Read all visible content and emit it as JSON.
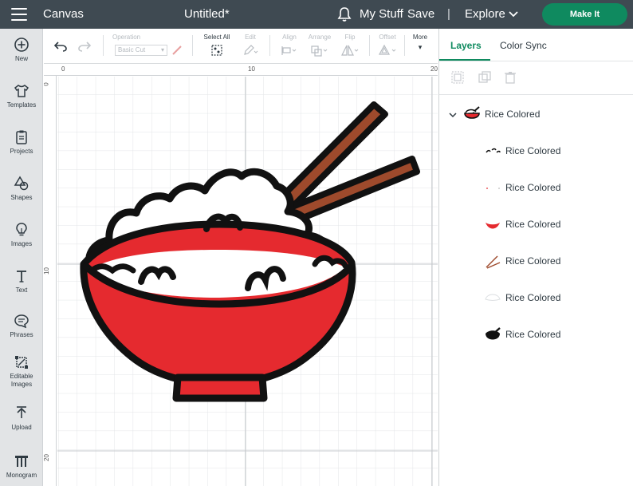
{
  "topbar": {
    "app_name": "Canvas",
    "doc_title": "Untitled*",
    "my_stuff": "My Stuff",
    "save": "Save",
    "separator": "|",
    "explore": "Explore",
    "make_it": "Make It",
    "make_it_color": "#0f8a5f",
    "bar_color": "#3f4a52"
  },
  "leftrail": {
    "items": [
      {
        "label": "New",
        "icon": "plus-circle-icon"
      },
      {
        "label": "Templates",
        "icon": "shirt-icon"
      },
      {
        "label": "Projects",
        "icon": "clipboard-icon"
      },
      {
        "label": "Shapes",
        "icon": "shapes-icon"
      },
      {
        "label": "Images",
        "icon": "lightbulb-icon"
      },
      {
        "label": "Text",
        "icon": "text-t-icon"
      },
      {
        "label": "Phrases",
        "icon": "speech-bubble-icon"
      },
      {
        "label": "Editable Images",
        "icon": "editable-images-icon"
      },
      {
        "label": "Upload",
        "icon": "upload-icon"
      },
      {
        "label": "Monogram",
        "icon": "monogram-icon"
      }
    ]
  },
  "toolbar": {
    "operation_label": "Operation",
    "operation_value": "Basic Cut",
    "select_all": "Select All",
    "edit": "Edit",
    "align": "Align",
    "arrange": "Arrange",
    "flip": "Flip",
    "offset": "Offset",
    "more": "More"
  },
  "rulers": {
    "top": [
      "0",
      "10",
      "20"
    ],
    "left": [
      "0",
      "10",
      "20"
    ]
  },
  "rightpanel": {
    "tabs": [
      "Layers",
      "Color Sync"
    ],
    "group": {
      "name": "Rice Colored",
      "icon": "rice-bowl-icon"
    },
    "layers": [
      {
        "name": "Rice Colored",
        "icon": "rice-lines-icon"
      },
      {
        "name": "Rice Colored",
        "icon": "rice-dots-icon"
      },
      {
        "name": "Rice Colored",
        "icon": "red-bowl-icon"
      },
      {
        "name": "Rice Colored",
        "icon": "chopsticks-icon"
      },
      {
        "name": "Rice Colored",
        "icon": "white-rice-icon"
      },
      {
        "name": "Rice Colored",
        "icon": "black-outline-icon"
      }
    ],
    "accent_color": "#0f8a5f"
  },
  "artwork": {
    "bowl_color": "#e52a2f",
    "chopstick_color": "#9e4a2c",
    "outline_color": "#111111"
  }
}
